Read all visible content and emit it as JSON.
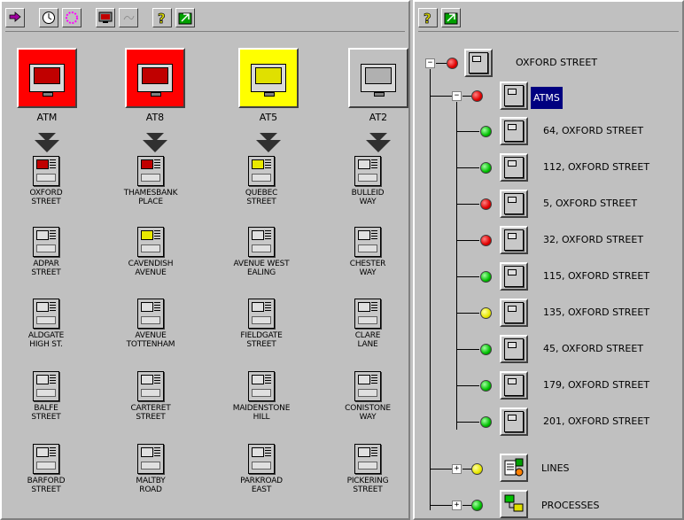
{
  "left_panel": {
    "big_items": [
      {
        "label": "ATM",
        "bg": "#ff0000",
        "screen": "#c00000"
      },
      {
        "label": "AT8",
        "bg": "#ff0000",
        "screen": "#c00000"
      },
      {
        "label": "AT5",
        "bg": "#ffff00",
        "screen": "#e0e000"
      },
      {
        "label": "AT2",
        "bg": "#c0c0c0",
        "screen": "#b0b0b0"
      }
    ],
    "atms": [
      {
        "label": "OXFORD\nSTREET",
        "screen": "#c00000"
      },
      {
        "label": "THAMESBANK\nPLACE",
        "screen": "#c00000"
      },
      {
        "label": "QUEBEC\nSTREET",
        "screen": "#e8e800"
      },
      {
        "label": "BULLEID\nWAY",
        "screen": "#e0e0e0"
      },
      {
        "label": "ADPAR\nSTREET",
        "screen": "#e0e0e0"
      },
      {
        "label": "CAVENDISH\nAVENUE",
        "screen": "#e8e800"
      },
      {
        "label": "AVENUE WEST\nEALING",
        "screen": "#e0e0e0"
      },
      {
        "label": "CHESTER\nWAY",
        "screen": "#e0e0e0"
      },
      {
        "label": "ALDGATE\nHIGH ST.",
        "screen": "#e0e0e0"
      },
      {
        "label": "AVENUE\nTOTTENHAM",
        "screen": "#e0e0e0"
      },
      {
        "label": "FIELDGATE\nSTREET",
        "screen": "#e0e0e0"
      },
      {
        "label": "CLARE\nLANE",
        "screen": "#e0e0e0"
      },
      {
        "label": "BALFE\nSTREET",
        "screen": "#e0e0e0"
      },
      {
        "label": "CARTERET\nSTREET",
        "screen": "#e0e0e0"
      },
      {
        "label": "MAIDENSTONE\nHILL",
        "screen": "#e0e0e0"
      },
      {
        "label": "CONISTONE\nWAY",
        "screen": "#e0e0e0"
      },
      {
        "label": "BARFORD\nSTREET",
        "screen": "#e0e0e0"
      },
      {
        "label": "MALTBY\nROAD",
        "screen": "#e0e0e0"
      },
      {
        "label": "PARKROAD\nEAST",
        "screen": "#e0e0e0"
      },
      {
        "label": "PICKERING\nSTREET",
        "screen": "#e0e0e0"
      }
    ]
  },
  "tree": {
    "root": {
      "label": "OXFORD    STREET",
      "status": "red"
    },
    "atms_node": {
      "label": "ATMS",
      "status": "red"
    },
    "children": [
      {
        "label": "64, OXFORD STREET",
        "status": "green"
      },
      {
        "label": "112, OXFORD STREET",
        "status": "green"
      },
      {
        "label": "5, OXFORD STREET",
        "status": "red"
      },
      {
        "label": "32, OXFORD STREET",
        "status": "red"
      },
      {
        "label": "115, OXFORD STREET",
        "status": "green"
      },
      {
        "label": "135, OXFORD STREET",
        "status": "yellow"
      },
      {
        "label": "45, OXFORD STREET",
        "status": "green"
      },
      {
        "label": "179, OXFORD STREET",
        "status": "green"
      },
      {
        "label": "201, OXFORD STREET",
        "status": "green"
      }
    ],
    "lines": {
      "label": "LINES",
      "status": "yellow"
    },
    "processes": {
      "label": "PROCESSES",
      "status": "green"
    }
  }
}
